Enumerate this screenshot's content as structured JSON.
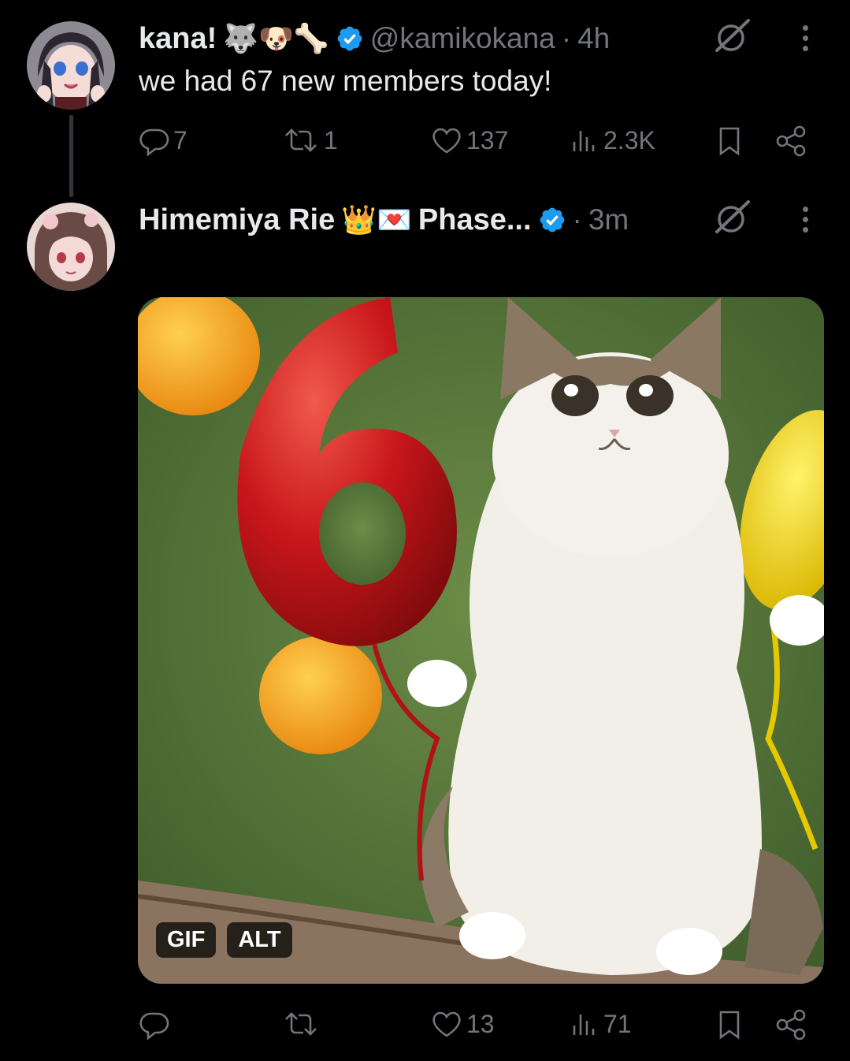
{
  "post1": {
    "display_name": "kana!",
    "name_emojis": "🐺🐶🦴",
    "handle": "@kamikokana",
    "separator": "·",
    "time": "4h",
    "text": "we had 67 new members today!",
    "actions": {
      "replies": "7",
      "reposts": "1",
      "likes": "137",
      "views": "2.3K"
    }
  },
  "post2": {
    "display_name": "Himemiya Rie",
    "name_emojis": "👑💌",
    "name_suffix": "Phase...",
    "separator": "·",
    "time": "3m",
    "media": {
      "badges": [
        "GIF",
        "ALT"
      ],
      "balloon_digit": "6"
    },
    "actions": {
      "replies": "",
      "reposts": "",
      "likes": "13",
      "views": "71"
    }
  },
  "colors": {
    "background": "#000000",
    "text_primary": "#e7e9ea",
    "text_secondary": "#71767b",
    "verified_blue": "#1d9bf0"
  }
}
